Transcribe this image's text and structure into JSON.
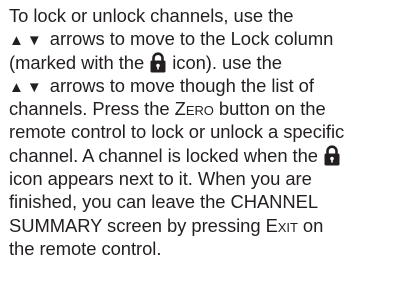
{
  "paragraph": {
    "l1": "To lock or unlock channels, use the",
    "l2_arrows": "▲▼",
    "l2": " arrows to move to the Lock column",
    "l3a": "(marked with the ",
    "l3b": " icon). use the",
    "l4_arrows": "▲▼",
    "l4": " arrows to  move though the list of",
    "l5": "channels. Press the ",
    "l5_key": "Zero",
    "l5b": " button on the",
    "l6": "remote control to lock or unlock a specific",
    "l7a": "channel. A channel is locked when the ",
    "l8": "icon appears next to it. When you are",
    "l9": "finished, you can leave the CHANNEL",
    "l10a": "SUMMARY screen by pressing ",
    "l10_key": "Exit",
    "l10b": " on",
    "l11": "the remote control."
  },
  "icons": {
    "lock": "padlock-icon"
  }
}
